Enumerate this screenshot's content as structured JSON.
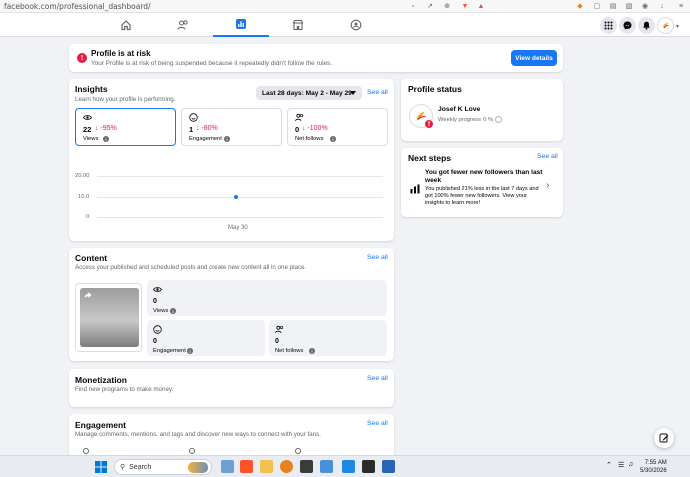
{
  "browser": {
    "url": "facebook.com/professional_dashboard/"
  },
  "alert": {
    "title": "Profile is at risk",
    "body": "Your Profile is at risk of being suspended because it repeatedly didn't follow the rules.",
    "button": "View details"
  },
  "insights": {
    "title": "Insights",
    "subtitle": "Learn how your profile is performing.",
    "date_range": "Last 28 days: May 2 - May 29",
    "see_all": "See all",
    "metrics": [
      {
        "value": "22",
        "change": "↓ -95%",
        "label": "Views"
      },
      {
        "value": "1",
        "change": "↓ -80%",
        "label": "Engagement"
      },
      {
        "value": "0",
        "change": "↓ -100%",
        "label": "Net follows"
      }
    ],
    "chart": {
      "y_ticks": [
        "20.00",
        "10.0",
        "0"
      ],
      "x_label": "May 30"
    }
  },
  "chart_data": {
    "type": "scatter",
    "x": [
      "May 30"
    ],
    "y": [
      10
    ],
    "ylim": [
      0,
      20
    ],
    "ytick_labels": [
      "20.00",
      "10.0",
      "0"
    ],
    "grid": true
  },
  "content": {
    "title": "Content",
    "subtitle": "Access your published and scheduled posts and create new content all in one place.",
    "see_all": "See all",
    "stats": [
      {
        "value": "0",
        "label": "Views"
      },
      {
        "value": "0",
        "label": "Engagement"
      },
      {
        "value": "0",
        "label": "Net follows"
      }
    ]
  },
  "monetization": {
    "title": "Monetization",
    "subtitle": "Find new programs to make money.",
    "see_all": "See all"
  },
  "engagement": {
    "title": "Engagement",
    "subtitle": "Manage comments, mentions, and tags and discover new ways to connect with your fans.",
    "see_all": "See all"
  },
  "profile_status": {
    "title": "Profile status",
    "name": "Josef K Love",
    "progress_label": "Weekly progress",
    "progress_value": "0 %",
    "progress_fraction": 0
  },
  "next_steps": {
    "title": "Next steps",
    "see_all": "See all",
    "item_title": "You got fewer new followers than last week",
    "item_body": "You published 21% less in the last 7 days and got 100% fewer new followers. View your insights to learn more!"
  },
  "taskbar": {
    "search_placeholder": "Search",
    "time": "7:55 AM",
    "date": "5/30/2026"
  },
  "colors": {
    "accent": "#1877f2",
    "danger": "#e41e3f"
  }
}
